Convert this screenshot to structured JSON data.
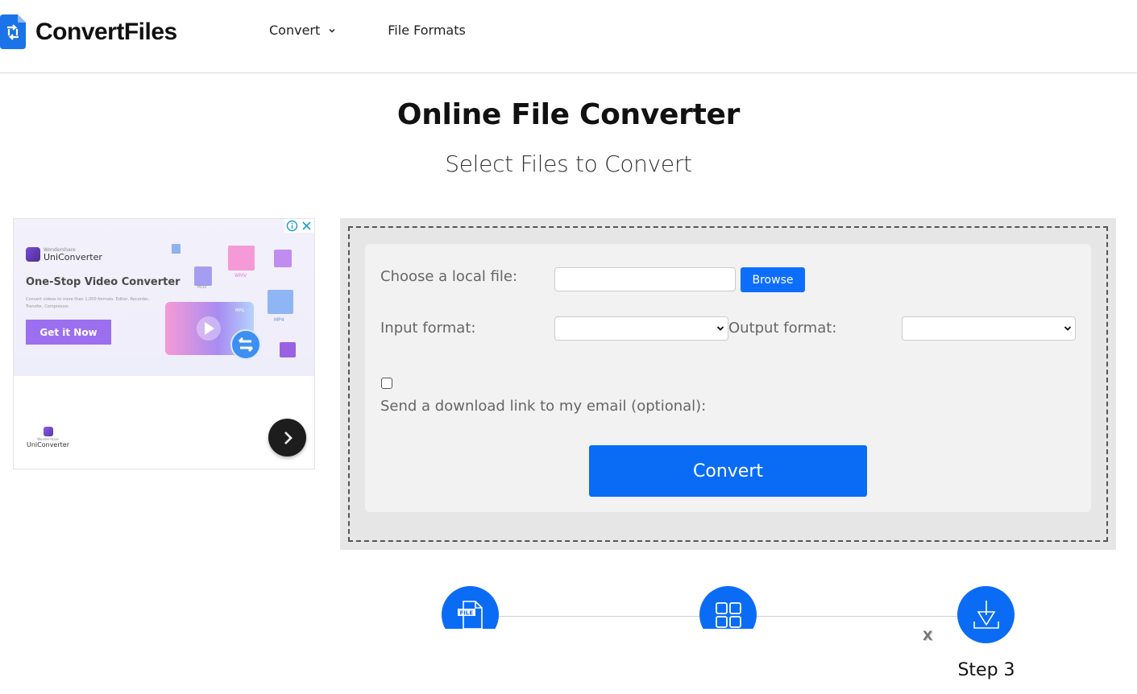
{
  "header": {
    "logo_text": "ConvertFiles",
    "nav": [
      {
        "label": "Convert",
        "has_dropdown": true
      },
      {
        "label": "File Formats",
        "has_dropdown": false
      }
    ]
  },
  "hero": {
    "title": "Online File Converter",
    "subtitle": "Select Files to Convert"
  },
  "ad": {
    "brand_small": "Wondershare",
    "brand_name": "UniConverter",
    "headline": "One-Stop Video Converter",
    "description": "Convert videos to more than 1,000 formats. Editor, Recorder, Transfer, Compressor.",
    "cta_label": "Get it Now",
    "format_tags": [
      "WMV",
      "MOV",
      "MP4",
      "MPG"
    ],
    "footer_small": "Wondershare",
    "footer_name": "UniConverter"
  },
  "converter": {
    "file_label": "Choose a local file:",
    "file_value": "",
    "browse_label": "Browse",
    "input_format_label": "Input format:",
    "input_format_value": "",
    "output_format_label": "Output format:",
    "output_format_value": "",
    "email_checkbox_checked": false,
    "email_label": "Send a download link to my email (optional):",
    "convert_label": "Convert"
  },
  "steps": {
    "visible_label": "Step 3",
    "close_label": "X",
    "icons": [
      "file-icon",
      "grid-icon",
      "download-icon"
    ]
  },
  "colors": {
    "primary": "#0a6cf5",
    "ad_accent": "#9b6ff0"
  }
}
